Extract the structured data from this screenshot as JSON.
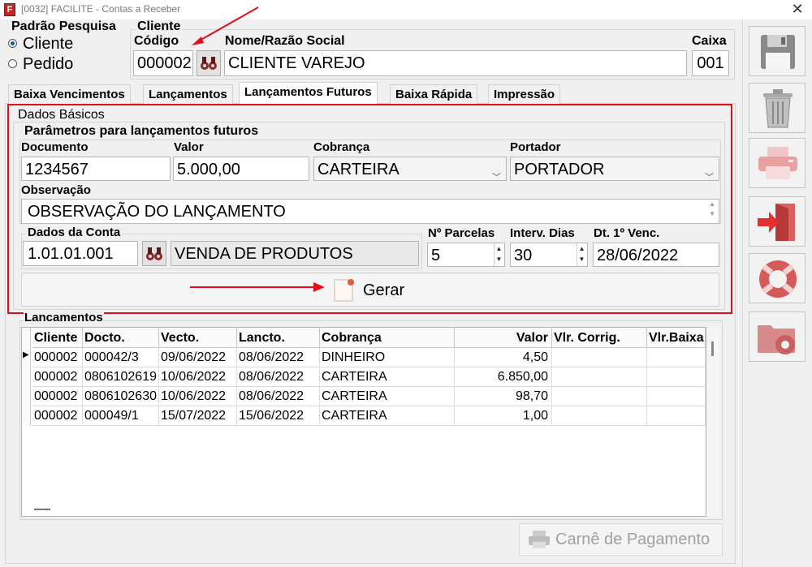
{
  "window": {
    "title": "[0032] FACILITE - Contas a Receber",
    "icon_letter": "F",
    "close": "✕"
  },
  "padrao": {
    "label": "Padrão Pesquisa",
    "options": [
      "Cliente",
      "Pedido"
    ],
    "selected": "Cliente"
  },
  "cliente": {
    "group_label": "Cliente",
    "codigo_label": "Código",
    "codigo": "000002",
    "nome_label": "Nome/Razão Social",
    "nome": "CLIENTE VAREJO",
    "caixa_label": "Caixa",
    "caixa": "001"
  },
  "tabs": [
    "Baixa Vencimentos",
    "Lançamentos",
    "Lançamentos Futuros",
    "Baixa Rápida",
    "Impressão"
  ],
  "active_tab": "Lançamentos Futuros",
  "dados_basicos": {
    "label": "Dados Básicos",
    "params_label": "Parâmetros para lançamentos futuros",
    "documento_label": "Documento",
    "documento": "1234567",
    "valor_label": "Valor",
    "valor": "5.000,00",
    "cobranca_label": "Cobrança",
    "cobranca": "CARTEIRA",
    "portador_label": "Portador",
    "portador": "PORTADOR",
    "observacao_label": "Observação",
    "observacao": "OBSERVAÇÃO DO LANÇAMENTO",
    "conta_label": "Dados da Conta",
    "conta_codigo": "1.01.01.001",
    "conta_nome": "VENDA DE PRODUTOS",
    "parcelas_label": "Nº Parcelas",
    "parcelas": "5",
    "intervalo_label": "Interv. Dias",
    "intervalo": "30",
    "vencimento_label": "Dt. 1º Venc.",
    "vencimento": "28/06/2022",
    "gerar_label": "Gerar"
  },
  "lancamentos": {
    "label": "Lançamentos",
    "columns": [
      "Cliente",
      "Docto.",
      "Vecto.",
      "Lancto.",
      "Cobrança",
      "Valor",
      "Vlr. Corrig.",
      "Vlr.Baixa"
    ],
    "rows": [
      [
        "000002",
        "000042/3",
        "09/06/2022",
        "08/06/2022",
        "DINHEIRO",
        "4,50",
        "",
        ""
      ],
      [
        "000002",
        "0806102619",
        "10/06/2022",
        "08/06/2022",
        "CARTEIRA",
        "6.850,00",
        "",
        ""
      ],
      [
        "000002",
        "0806102630",
        "10/06/2022",
        "08/06/2022",
        "CARTEIRA",
        "98,70",
        "",
        ""
      ],
      [
        "000002",
        "000049/1",
        "15/07/2022",
        "15/06/2022",
        "CARTEIRA",
        "1,00",
        "",
        ""
      ]
    ]
  },
  "carne_label": "Carnê de Pagamento",
  "sidebar": [
    "save",
    "delete",
    "print",
    "exit",
    "help",
    "settings-folder"
  ],
  "colors": {
    "annotation": "#e0101a",
    "radio": "#0060c0"
  }
}
